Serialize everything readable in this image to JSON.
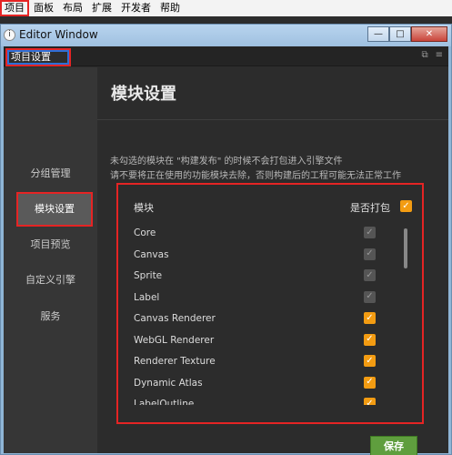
{
  "menubar": {
    "items": [
      "项目",
      "面板",
      "布局",
      "扩展",
      "开发者",
      "帮助"
    ]
  },
  "window": {
    "title": "Editor Window",
    "buttons": {
      "minimize": "—",
      "maximize": "□",
      "close": "✕"
    }
  },
  "tab": {
    "label": "项目设置"
  },
  "sidebar": {
    "items": [
      {
        "label": "分组管理",
        "active": false
      },
      {
        "label": "模块设置",
        "active": true
      },
      {
        "label": "项目预览",
        "active": false
      },
      {
        "label": "自定义引擎",
        "active": false
      },
      {
        "label": "服务",
        "active": false
      }
    ]
  },
  "content": {
    "heading": "模块设置",
    "desc_line1": "未勾选的模块在 \"构建发布\" 的时候不会打包进入引擎文件",
    "desc_line2": "请不要将正在使用的功能模块去除，否则构建后的工程可能无法正常工作",
    "header_module": "模块",
    "header_pack": "是否打包",
    "modules": [
      {
        "name": "Core",
        "checked": true,
        "disabled": true
      },
      {
        "name": "Canvas",
        "checked": true,
        "disabled": true
      },
      {
        "name": "Sprite",
        "checked": true,
        "disabled": true
      },
      {
        "name": "Label",
        "checked": true,
        "disabled": true
      },
      {
        "name": "Canvas Renderer",
        "checked": true,
        "disabled": false
      },
      {
        "name": "WebGL Renderer",
        "checked": true,
        "disabled": false
      },
      {
        "name": "Renderer Texture",
        "checked": true,
        "disabled": false
      },
      {
        "name": "Dynamic Atlas",
        "checked": true,
        "disabled": false
      },
      {
        "name": "LabelOutline",
        "checked": true,
        "disabled": false
      }
    ],
    "save_label": "保存"
  },
  "colors": {
    "highlight": "#e52424",
    "accent": "#f39c12",
    "save": "#5f9e3e"
  }
}
